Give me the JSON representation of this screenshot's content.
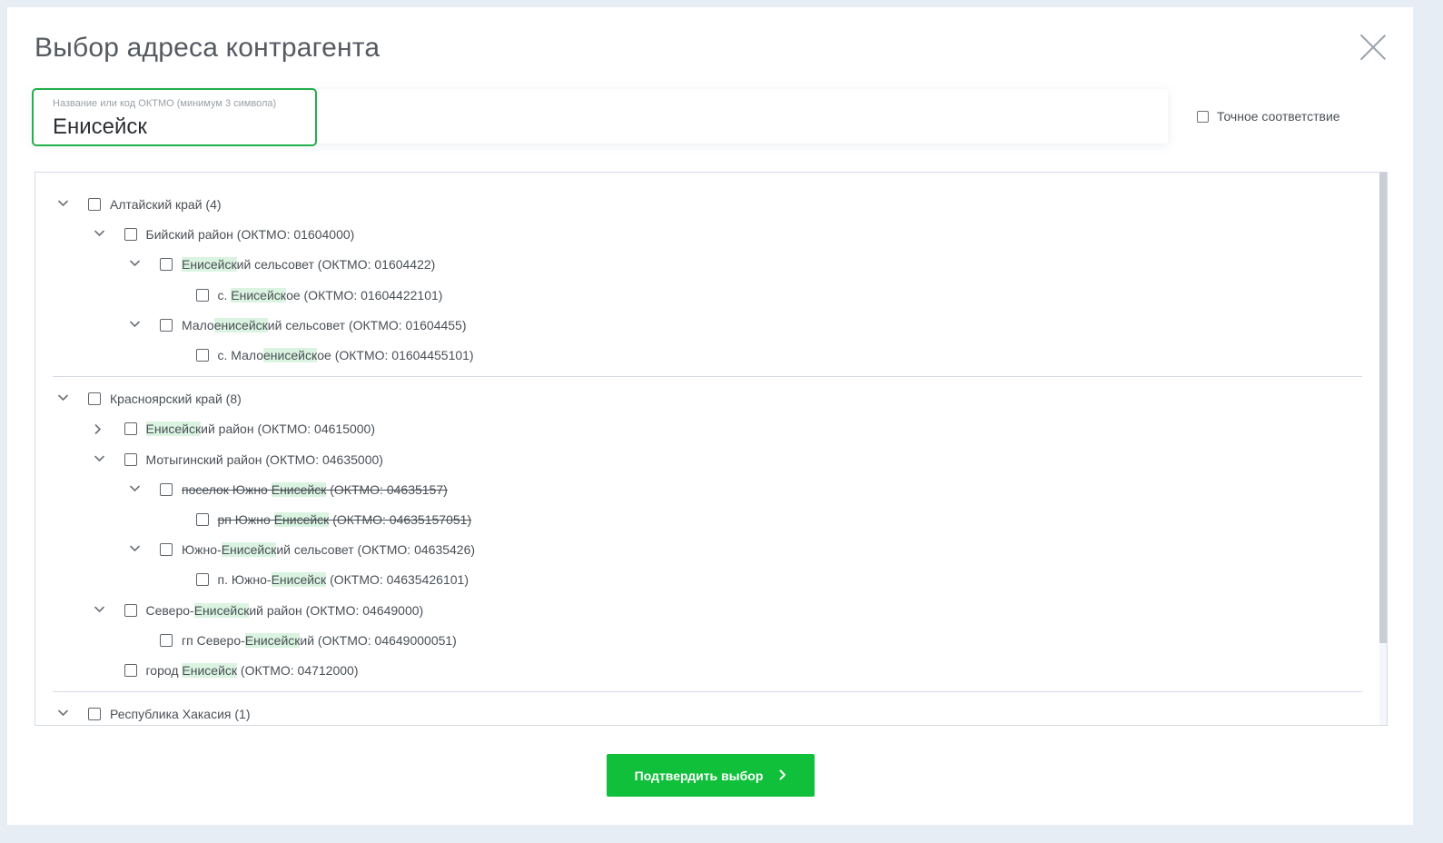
{
  "modal": {
    "title": "Выбор адреса контрагента"
  },
  "search": {
    "label": "Название или код ОКТМО (минимум 3 символа)",
    "value": "Енисейск"
  },
  "exact_match": {
    "label": "Точное соответствие",
    "checked": false
  },
  "tree": {
    "rows": [
      {
        "level": 0,
        "expand": "down",
        "parts": [
          {
            "t": "Алтайский край (4)"
          }
        ]
      },
      {
        "level": 1,
        "expand": "down",
        "parts": [
          {
            "t": "Бийский район (ОКТМО: 01604000)"
          }
        ]
      },
      {
        "level": 2,
        "expand": "down",
        "parts": [
          {
            "t": "Енисейск",
            "hl": true
          },
          {
            "t": "ий сельсовет (ОКТМО: 01604422)"
          }
        ]
      },
      {
        "level": 3,
        "expand": "none",
        "parts": [
          {
            "t": "с. "
          },
          {
            "t": "Енисейск",
            "hl": true
          },
          {
            "t": "ое (ОКТМО: 01604422101)"
          }
        ]
      },
      {
        "level": 2,
        "expand": "down",
        "parts": [
          {
            "t": "Мало"
          },
          {
            "t": "енисейск",
            "hl": true
          },
          {
            "t": "ий сельсовет (ОКТМО: 01604455)"
          }
        ]
      },
      {
        "level": 3,
        "expand": "none",
        "parts": [
          {
            "t": "с. Мало"
          },
          {
            "t": "енисейск",
            "hl": true
          },
          {
            "t": "ое (ОКТМО: 01604455101)"
          }
        ]
      },
      {
        "divider": true
      },
      {
        "level": 0,
        "expand": "down",
        "parts": [
          {
            "t": "Красноярский край (8)"
          }
        ]
      },
      {
        "level": 1,
        "expand": "right",
        "parts": [
          {
            "t": "Енисейск",
            "hl": true
          },
          {
            "t": "ий район (ОКТМО: 04615000)"
          }
        ]
      },
      {
        "level": 1,
        "expand": "down",
        "parts": [
          {
            "t": "Мотыгинский район (ОКТМО: 04635000)"
          }
        ]
      },
      {
        "level": 2,
        "expand": "down",
        "struck": true,
        "parts": [
          {
            "t": "поселок Южно "
          },
          {
            "t": "Енисейск",
            "hl": true
          },
          {
            "t": " (ОКТМО: 04635157)"
          }
        ]
      },
      {
        "level": 3,
        "expand": "none",
        "struck": true,
        "parts": [
          {
            "t": "рп Южно "
          },
          {
            "t": "Енисейск",
            "hl": true
          },
          {
            "t": " (ОКТМО: 04635157051)"
          }
        ]
      },
      {
        "level": 2,
        "expand": "down",
        "parts": [
          {
            "t": "Южно-"
          },
          {
            "t": "Енисейск",
            "hl": true
          },
          {
            "t": "ий сельсовет (ОКТМО: 04635426)"
          }
        ]
      },
      {
        "level": 3,
        "expand": "none",
        "parts": [
          {
            "t": "п. Южно-"
          },
          {
            "t": "Енисейск",
            "hl": true
          },
          {
            "t": " (ОКТМО: 04635426101)"
          }
        ]
      },
      {
        "level": 1,
        "expand": "down",
        "parts": [
          {
            "t": "Северо-"
          },
          {
            "t": "Енисейск",
            "hl": true
          },
          {
            "t": "ий район (ОКТМО: 04649000)"
          }
        ]
      },
      {
        "level": 2,
        "expand": "none",
        "parts": [
          {
            "t": "гп Северо-"
          },
          {
            "t": "Енисейск",
            "hl": true
          },
          {
            "t": "ий (ОКТМО: 04649000051)"
          }
        ]
      },
      {
        "level": 1,
        "expand": "none",
        "parts": [
          {
            "t": "город "
          },
          {
            "t": "Енисейск",
            "hl": true
          },
          {
            "t": " (ОКТМО: 04712000)"
          }
        ]
      },
      {
        "divider": true
      },
      {
        "level": 0,
        "expand": "down",
        "parts": [
          {
            "t": "Республика Хакасия (1)"
          }
        ]
      }
    ]
  },
  "confirm": {
    "label": "Подтвердить выбор"
  },
  "colors": {
    "accent": "#11c03a",
    "focus_border": "#22b04b",
    "highlight": "#dbf3e1"
  }
}
